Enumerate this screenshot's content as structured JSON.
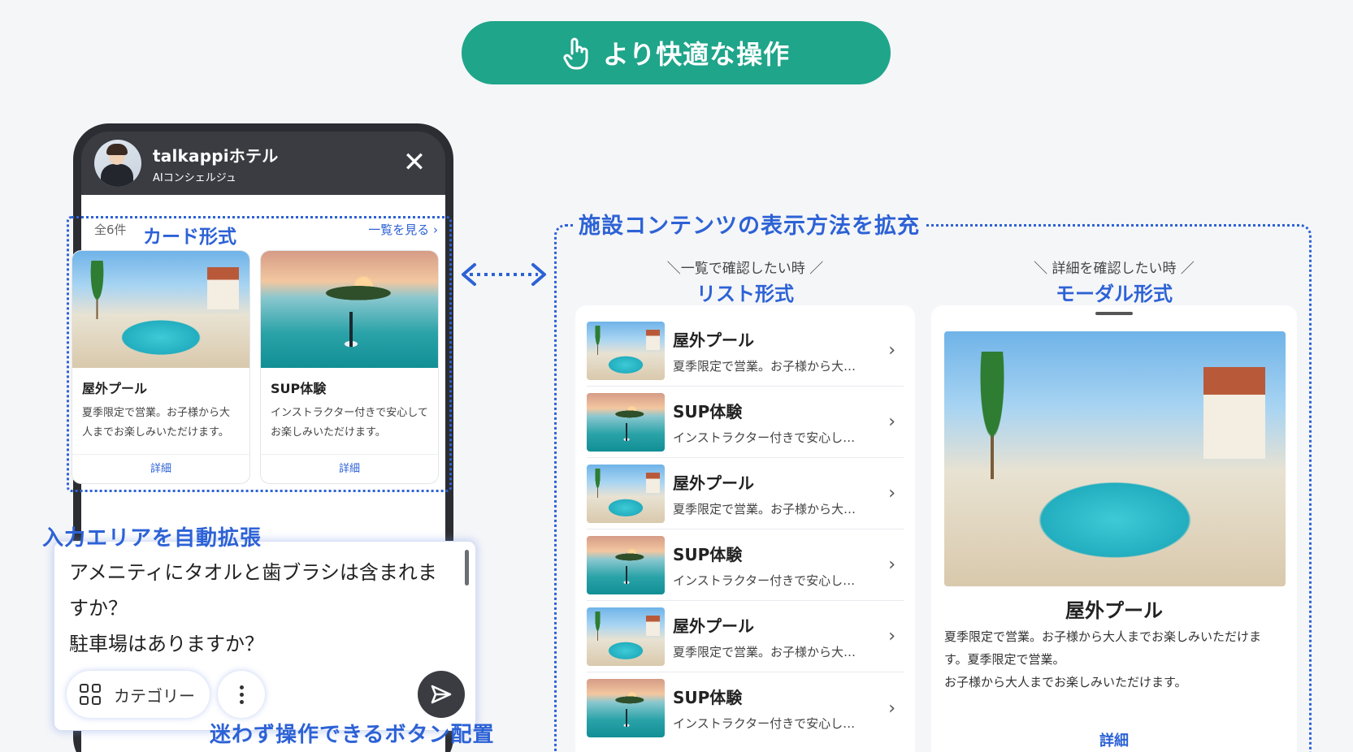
{
  "banner": {
    "label": "より快適な操作",
    "icon": "tap-hand-icon"
  },
  "chat_header": {
    "title": "talkappiホテル",
    "subtitle": "AIコンシェルジュ",
    "close_icon": "✕"
  },
  "card_section": {
    "count": "全6件",
    "feature_label": "カード形式",
    "see_all": "一覧を見る ›",
    "cards": [
      {
        "title": "屋外プール",
        "desc": "夏季限定で営業。お子様から大人までお楽しみいただけます。",
        "link": "詳細",
        "image": "pool"
      },
      {
        "title": "SUP体験",
        "desc": "インストラクター付きで安心してお楽しみいただけます。",
        "link": "詳細",
        "image": "sup"
      }
    ]
  },
  "input_area": {
    "feature_label": "入力エリアを自動拡張",
    "lines": [
      "アメニティにタオルと歯ブラシは含まれますか？",
      "駐車場はありますか？"
    ],
    "category_button": "カテゴリー",
    "button_feature_label": "迷わず操作できるボタン配置"
  },
  "right_section": {
    "title": "施設コンテンツの表示方法を拡充",
    "list": {
      "caption": "＼一覧で確認したい時 ／",
      "label": "リスト形式",
      "items": [
        {
          "title": "屋外プール",
          "desc": "夏季限定で営業。お子様から大…",
          "image": "pool"
        },
        {
          "title": "SUP体験",
          "desc": "インストラクター付きで安心し…",
          "image": "sup"
        },
        {
          "title": "屋外プール",
          "desc": "夏季限定で営業。お子様から大…",
          "image": "pool"
        },
        {
          "title": "SUP体験",
          "desc": "インストラクター付きで安心し…",
          "image": "sup"
        },
        {
          "title": "屋外プール",
          "desc": "夏季限定で営業。お子様から大…",
          "image": "pool"
        },
        {
          "title": "SUP体験",
          "desc": "インストラクター付きで安心し…",
          "image": "sup"
        }
      ]
    },
    "modal": {
      "caption": "＼ 詳細を確認したい時 ／",
      "label": "モーダル形式",
      "title": "屋外プール",
      "desc_lines": [
        "夏季限定で営業。お子様から大人までお楽しみいただけま",
        "す。夏季限定で営業。",
        "お子様から大人までお楽しみいただけます。"
      ],
      "link": "詳細"
    }
  },
  "colors": {
    "accent_green": "#1fa58a",
    "brand_blue": "#2d62d6",
    "phone_dark": "#3a3c42"
  }
}
